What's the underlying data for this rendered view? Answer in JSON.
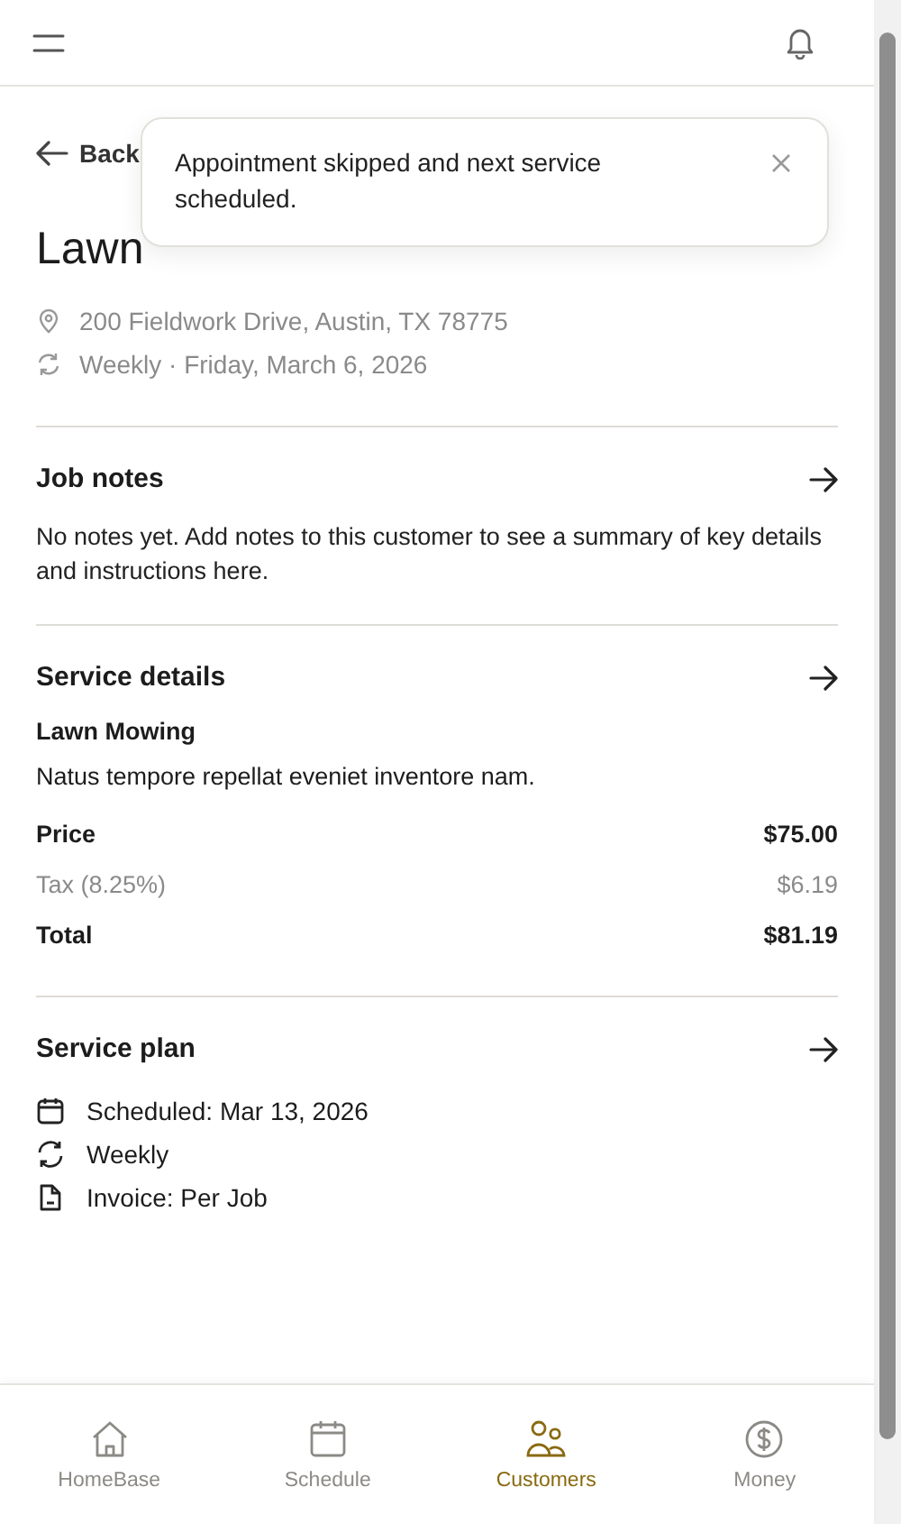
{
  "back": {
    "label": "Back"
  },
  "toast": {
    "message": "Appointment skipped and next service scheduled."
  },
  "job": {
    "title": "Lawn",
    "address": "200 Fieldwork Drive, Austin, TX 78775",
    "recurrence": "Weekly · Friday, March 6, 2026"
  },
  "job_notes": {
    "title": "Job notes",
    "text": "No notes yet. Add notes to this customer to see a summary of key details and instructions here."
  },
  "service_details": {
    "title": "Service details",
    "service_name": "Lawn Mowing",
    "description": "Natus tempore repellat eveniet inventore nam.",
    "lines": [
      {
        "kind": "strong",
        "label": "Price",
        "amount": "$75.00"
      },
      {
        "kind": "muted",
        "label": "Tax (8.25%)",
        "amount": "$6.19"
      },
      {
        "kind": "strong",
        "label": "Total",
        "amount": "$81.19"
      }
    ]
  },
  "service_plan": {
    "title": "Service plan",
    "items": [
      {
        "kind": "calendar",
        "text": "Scheduled: Mar 13, 2026"
      },
      {
        "kind": "repeat",
        "text": "Weekly"
      },
      {
        "kind": "document",
        "text": "Invoice: Per Job"
      }
    ]
  },
  "nav": [
    {
      "kind": "home",
      "label": "HomeBase",
      "selected": false
    },
    {
      "kind": "calendar",
      "label": "Schedule",
      "selected": false
    },
    {
      "kind": "people",
      "label": "Customers",
      "selected": true
    },
    {
      "kind": "money",
      "label": "Money",
      "selected": false
    }
  ]
}
